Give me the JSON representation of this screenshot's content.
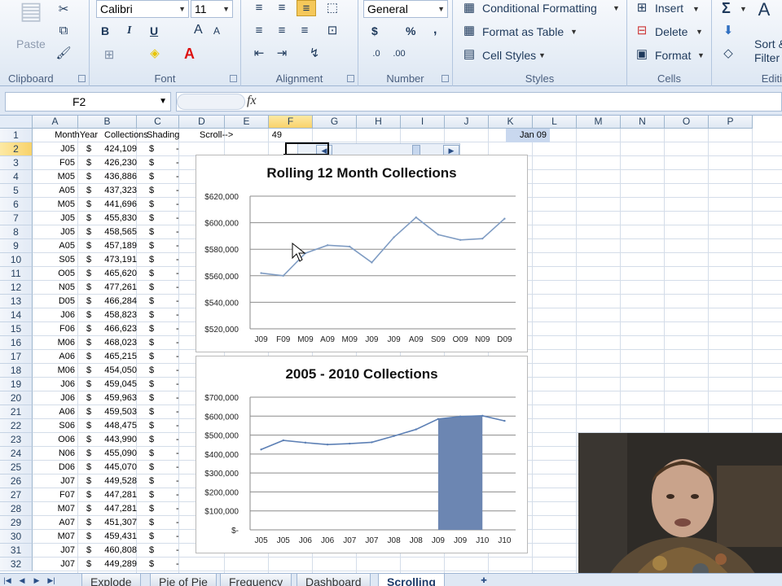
{
  "ribbon": {
    "clipboard": {
      "label": "Clipboard",
      "paste": "Paste"
    },
    "font": {
      "label": "Font",
      "name": "Calibri",
      "size": "11",
      "bold": "B",
      "italic": "I",
      "underline": "U",
      "grow": "A",
      "shrink": "A",
      "font_color": "A"
    },
    "alignment": {
      "label": "Alignment"
    },
    "number": {
      "label": "Number",
      "format": "General",
      "currency": "$",
      "percent": "%",
      "comma": ",",
      "inc_dec": "←.0\n.00",
      "dec_dec": ".00\n→.0"
    },
    "styles": {
      "label": "Styles",
      "conditional": "Conditional Formatting",
      "format_table": "Format as Table",
      "cell_styles": "Cell Styles"
    },
    "cells": {
      "label": "Cells",
      "insert": "Insert",
      "delete": "Delete",
      "format": "Format"
    },
    "editing": {
      "label": "Editi",
      "sum": "Σ",
      "sort": "Sort &",
      "filter": "Filter"
    }
  },
  "formula_bar": {
    "name_box": "F2",
    "fx": "fx",
    "formula": ""
  },
  "columns": [
    "A",
    "B",
    "C",
    "D",
    "E",
    "F",
    "G",
    "H",
    "I",
    "J",
    "K",
    "L",
    "M",
    "N",
    "O",
    "P"
  ],
  "rows": [
    "1",
    "2",
    "3",
    "4",
    "5",
    "6",
    "7",
    "8",
    "9",
    "10",
    "11",
    "12",
    "13",
    "14",
    "15",
    "16",
    "17",
    "18",
    "19",
    "20",
    "21",
    "22",
    "23",
    "24",
    "25",
    "26",
    "27",
    "28",
    "29",
    "30",
    "31",
    "32"
  ],
  "sheet": {
    "headers": {
      "a": "MonthYear",
      "b": "Collections",
      "c": "Shading",
      "d": "Scroll-->",
      "e": "49",
      "k": "Jan 09"
    },
    "data": [
      [
        "J05",
        "424,109"
      ],
      [
        "F05",
        "426,230"
      ],
      [
        "M05",
        "436,886"
      ],
      [
        "A05",
        "437,323"
      ],
      [
        "M05",
        "441,696"
      ],
      [
        "J05",
        "455,830"
      ],
      [
        "J05",
        "458,565"
      ],
      [
        "A05",
        "457,189"
      ],
      [
        "S05",
        "473,191"
      ],
      [
        "O05",
        "465,620"
      ],
      [
        "N05",
        "477,261"
      ],
      [
        "D05",
        "466,284"
      ],
      [
        "J06",
        "458,823"
      ],
      [
        "F06",
        "466,623"
      ],
      [
        "M06",
        "468,023"
      ],
      [
        "A06",
        "465,215"
      ],
      [
        "M06",
        "454,050"
      ],
      [
        "J06",
        "459,045"
      ],
      [
        "J06",
        "459,963"
      ],
      [
        "A06",
        "459,503"
      ],
      [
        "S06",
        "448,475"
      ],
      [
        "O06",
        "443,990"
      ],
      [
        "N06",
        "455,090"
      ],
      [
        "D06",
        "445,070"
      ],
      [
        "J07",
        "449,528"
      ],
      [
        "F07",
        "447,281"
      ],
      [
        "M07",
        "447,281"
      ],
      [
        "A07",
        "451,307"
      ],
      [
        "M07",
        "459,431"
      ],
      [
        "J07",
        "460,808"
      ],
      [
        "J07",
        "449,289"
      ]
    ],
    "currency_symbol": "$",
    "shading_dash": "-"
  },
  "chart1": {
    "title": "Rolling 12 Month Collections",
    "chart_data": {
      "type": "line",
      "title": "Rolling 12 Month Collections",
      "categories": [
        "J09",
        "F09",
        "M09",
        "A09",
        "M09",
        "J09",
        "J09",
        "A09",
        "S09",
        "O09",
        "N09",
        "D09"
      ],
      "values": [
        562000,
        560000,
        577000,
        583000,
        582000,
        570000,
        589000,
        604000,
        591000,
        587000,
        588000,
        603000
      ],
      "ylim": [
        520000,
        620000
      ],
      "yticks": [
        "$520,000",
        "$540,000",
        "$560,000",
        "$580,000",
        "$600,000",
        "$620,000"
      ],
      "color": "#7f9cc3",
      "grid": true
    }
  },
  "chart2": {
    "title": "2005 - 2010 Collections",
    "chart_data": {
      "type": "area",
      "title": "2005 - 2010 Collections",
      "categories": [
        "J05",
        "J05",
        "J06",
        "J06",
        "J07",
        "J07",
        "J08",
        "J08",
        "J09",
        "J09",
        "J10",
        "J10"
      ],
      "values": [
        424000,
        472000,
        460000,
        450000,
        455000,
        462000,
        495000,
        530000,
        585000,
        598000,
        602000,
        575000
      ],
      "shaded_from": 8,
      "shaded_to": 10,
      "ylim": [
        0,
        700000
      ],
      "yticks": [
        "$-",
        "$100,000",
        "$200,000",
        "$300,000",
        "$400,000",
        "$500,000",
        "$600,000",
        "$700,000"
      ],
      "line_color": "#5d80b5",
      "shade_color": "#6c86b2",
      "grid": true
    }
  },
  "tabs": {
    "items": [
      "Explode",
      "Pie of Pie",
      "Frequency",
      "Dashboard",
      "Scrolling"
    ],
    "active": "Scrolling"
  }
}
